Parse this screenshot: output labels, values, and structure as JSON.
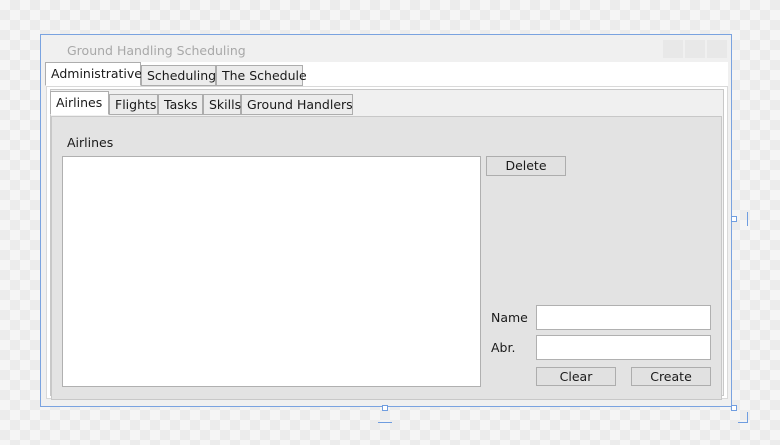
{
  "window": {
    "title": "Ground Handling Scheduling"
  },
  "outer_tabs": [
    {
      "label": "Administrative",
      "active": true
    },
    {
      "label": "Scheduling",
      "active": false
    },
    {
      "label": "The Schedule",
      "active": false
    }
  ],
  "inner_tabs": [
    {
      "label": "Airlines",
      "active": true
    },
    {
      "label": "Flights",
      "active": false
    },
    {
      "label": "Tasks",
      "active": false
    },
    {
      "label": "Skills",
      "active": false
    },
    {
      "label": "Ground Handlers",
      "active": false
    }
  ],
  "airlines_panel": {
    "heading": "Airlines",
    "list_items": [],
    "delete_label": "Delete",
    "name_label": "Name",
    "name_value": "",
    "abbr_label": "Abr.",
    "abbr_value": "",
    "clear_label": "Clear",
    "create_label": "Create"
  },
  "colors": {
    "selection_border": "#7aa3e0",
    "title_text": "#a8a8a8",
    "panel_bg": "#e3e3e3",
    "button_bg": "#e1e1e1"
  }
}
